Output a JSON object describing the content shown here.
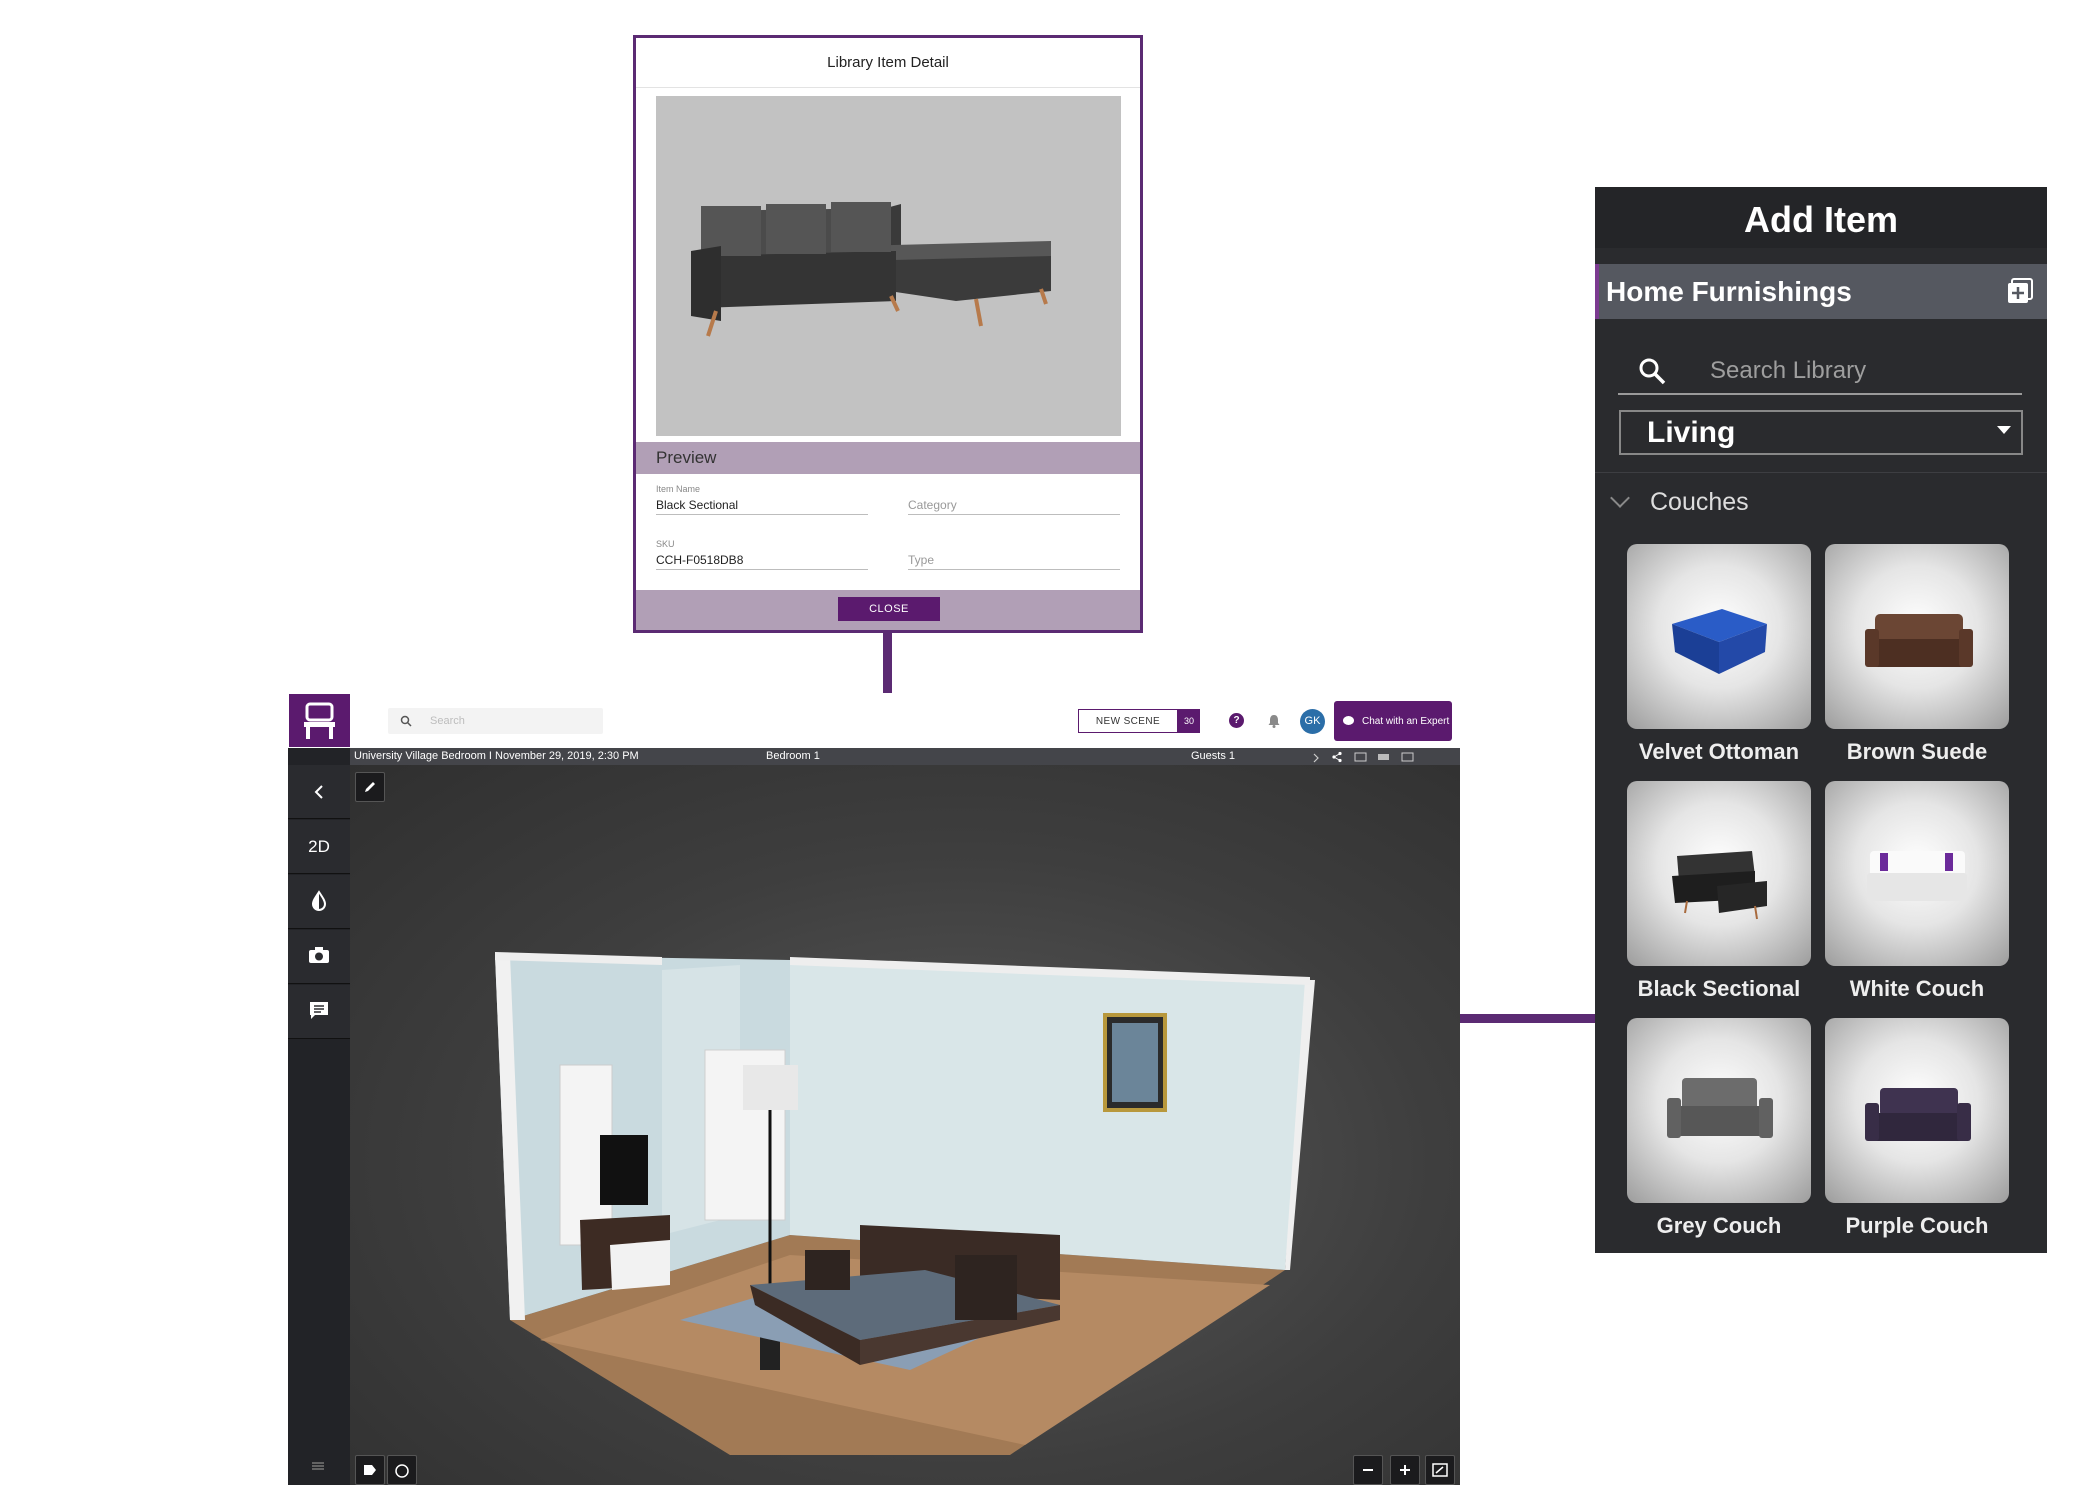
{
  "detail": {
    "title": "Library Item Detail",
    "preview_label": "Preview",
    "item_name_label": "Item Name",
    "item_name_value": "Black Sectional",
    "category_placeholder": "Category",
    "sku_label": "SKU",
    "sku_value": "CCH-F0518DB8",
    "type_placeholder": "Type",
    "close_label": "CLOSE"
  },
  "add_item": {
    "title": "Add Item",
    "category": "Home Furnishings",
    "search_placeholder": "Search Library",
    "room_select": "Living",
    "section": "Couches",
    "items": [
      {
        "label": "Velvet Ottoman",
        "color": "#1f45a3"
      },
      {
        "label": "Brown Suede",
        "color": "#5a3a2a"
      },
      {
        "label": "Black Sectional",
        "color": "#2a2a2a"
      },
      {
        "label": "White Couch",
        "color": "#f2f2f2"
      },
      {
        "label": "Grey Couch",
        "color": "#5d5d5d"
      },
      {
        "label": "Purple Couch",
        "color": "#3a2e45"
      }
    ]
  },
  "app": {
    "search_placeholder": "Search",
    "new_scene_label": "NEW SCENE",
    "new_scene_count": "30",
    "help_glyph": "?",
    "avatar_initials": "GK",
    "chat_label": "Chat with an Expert",
    "info_scene": "University Village Bedroom I November 29, 2019, 2:30 PM",
    "info_room": "Bedroom 1",
    "info_guests": "Guests 1",
    "sidebar_2d": "2D",
    "accent": "#5b1a6e"
  }
}
